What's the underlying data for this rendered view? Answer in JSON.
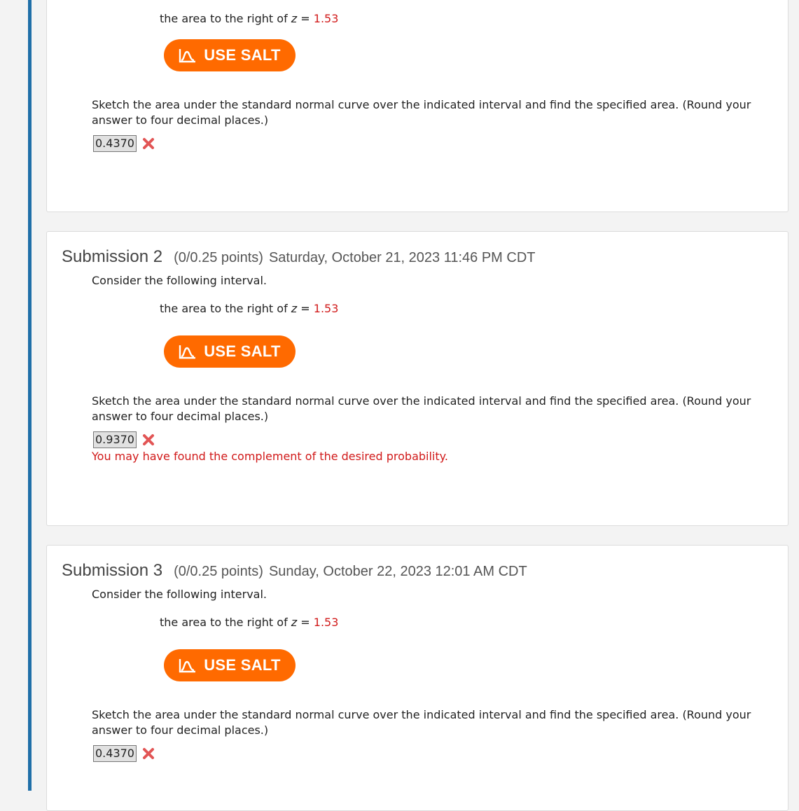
{
  "salt_label": "USE SALT",
  "submissions": [
    {
      "interval_text": "the area to the right of ",
      "interval_var": "z",
      "interval_eq": " = ",
      "interval_value": "1.53",
      "question": "Sketch the area under the standard normal curve over the indicated interval and find the specified area. (Round your answer to four decimal places.)",
      "answer": "0.4370"
    },
    {
      "title": "Submission 2",
      "points": "(0/0.25 points)",
      "date": "Saturday, October 21, 2023 11:46 PM CDT",
      "intro": "Consider the following interval.",
      "interval_text": "the area to the right of ",
      "interval_var": "z",
      "interval_eq": " = ",
      "interval_value": "1.53",
      "question": "Sketch the area under the standard normal curve over the indicated interval and find the specified area. (Round your answer to four decimal places.)",
      "answer": "0.9370",
      "feedback": "You may have found the complement of the desired probability."
    },
    {
      "title": "Submission 3",
      "points": "(0/0.25 points)",
      "date": "Sunday, October 22, 2023 12:01 AM CDT",
      "intro": "Consider the following interval.",
      "interval_text": "the area to the right of ",
      "interval_var": "z",
      "interval_eq": " = ",
      "interval_value": "1.53",
      "question": "Sketch the area under the standard normal curve over the indicated interval and find the specified area. (Round your answer to four decimal places.)",
      "answer": "0.4370"
    }
  ],
  "colors": {
    "accent_rail": "#1f6fa8",
    "salt_orange": "#ff6a00",
    "error_red": "#d11a1a"
  },
  "icons": {
    "salt": "salt-curve-icon",
    "incorrect": "incorrect-x-icon"
  }
}
